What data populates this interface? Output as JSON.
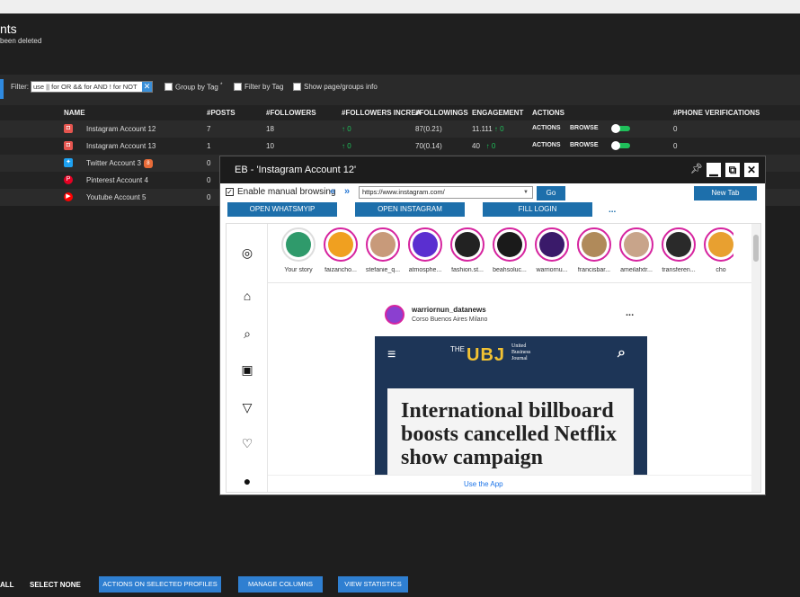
{
  "header": {
    "title": "nts",
    "subtitle": "been deleted"
  },
  "filter": {
    "label": "Filter:",
    "value": "use || for OR && for AND ! for NOT",
    "clear_icon": "close-icon",
    "group_by_tag": "Group by Tag",
    "group_by_tag_suffix": "*",
    "filter_by_tag": "Filter by Tag",
    "show_info": "Show page/groups info"
  },
  "table": {
    "columns": {
      "name": "NAME",
      "posts": "#POSTS",
      "followers": "#FOLLOWERS",
      "followers_increase": "#FOLLOWERS INCREA",
      "followings": "#FOLLOWINGS",
      "engagement": "ENGAGEMENT",
      "actions": "ACTIONS",
      "phone": "#PHONE VERIFICATIONS"
    },
    "rows": [
      {
        "name": "Instagram Account 12",
        "icon": "instagram-icon",
        "color": "#e5554f",
        "posts": "7",
        "followers": "18",
        "followers_increase": "0",
        "followings": "87(0.21)",
        "engagement": "11.111",
        "engagement_inc": "0",
        "action1": "ACTIONS",
        "action2": "BROWSE",
        "phone": "0"
      },
      {
        "name": "Instagram Account 13",
        "icon": "instagram-icon",
        "color": "#e5554f",
        "posts": "1",
        "followers": "10",
        "followers_increase": "0",
        "followings": "70(0.14)",
        "engagement": "40",
        "engagement_inc": "0",
        "action1": "ACTIONS",
        "action2": "BROWSE",
        "phone": "0"
      },
      {
        "name": "Twitter Account 3",
        "icon": "twitter-icon",
        "color": "#1da1f2",
        "badge": "8",
        "posts": "0"
      },
      {
        "name": "Pinterest Account 4",
        "icon": "pinterest-icon",
        "color": "#e60023",
        "posts": "0"
      },
      {
        "name": "Youtube Account 5",
        "icon": "youtube-icon",
        "color": "#ff0000",
        "posts": "0"
      }
    ]
  },
  "bottom": {
    "select_all": "ALL",
    "select_none": "SELECT NONE",
    "actions_selected": "ACTIONS ON SELECTED PROFILES",
    "manage_columns": "MANAGE COLUMNS",
    "view_statistics": "VIEW STATISTICS"
  },
  "popup": {
    "title": "EB - 'Instagram Account 12'",
    "enable_manual": "Enable manual browsing",
    "back": "«",
    "forward": "»",
    "url": "https://www.instagram.com/",
    "go": "Go",
    "new_tab": "New Tab",
    "open_whatsmyip": "OPEN WHATSMYIP",
    "open_instagram": "OPEN INSTAGRAM",
    "fill_login": "FILL LOGIN",
    "more": "...",
    "stories": [
      {
        "name": "Your story",
        "color": "#2f9a6b"
      },
      {
        "name": "faizancho...",
        "color": "#f0a020"
      },
      {
        "name": "stefanie_q...",
        "color": "#c89a7a"
      },
      {
        "name": "atmosphe...",
        "color": "#5a2fd0"
      },
      {
        "name": "fashion.st...",
        "color": "#222222"
      },
      {
        "name": "beahsoluc...",
        "color": "#1a1a1a"
      },
      {
        "name": "warriornu...",
        "color": "#3a1a6a"
      },
      {
        "name": "francisbar...",
        "color": "#b08a5a"
      },
      {
        "name": "ameilafxtr...",
        "color": "#c8a48a"
      },
      {
        "name": "transferen...",
        "color": "#2a2a2a"
      },
      {
        "name": "cho",
        "color": "#e8a030"
      }
    ],
    "post": {
      "user": "warriornun_datanews",
      "location": "Corso Buenos Aires Milano",
      "more": "...",
      "ubj_the": "THE",
      "ubj_logo": "UBJ",
      "ubj_sub": "United\nBusiness\nJournal",
      "headline": "International billboard boosts cancelled Netflix show campaign"
    },
    "use_app": "Use the App"
  }
}
